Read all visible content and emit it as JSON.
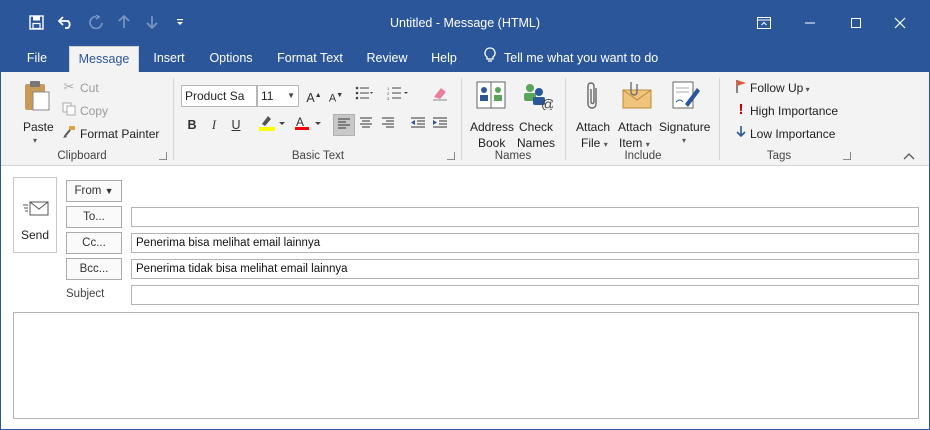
{
  "window": {
    "title": "Untitled  -  Message (HTML)"
  },
  "qat": {
    "save_icon": "save-icon",
    "undo_icon": "undo-icon",
    "redo_icon": "redo-icon",
    "up_icon": "arrow-up-icon",
    "down_icon": "arrow-down-icon",
    "customize_icon": "customize-icon"
  },
  "tabs": {
    "file": "File",
    "message": "Message",
    "insert": "Insert",
    "options": "Options",
    "format_text": "Format Text",
    "review": "Review",
    "help": "Help",
    "tell_me": "Tell me what you want to do"
  },
  "ribbon": {
    "clipboard": {
      "paste": "Paste",
      "cut": "Cut",
      "copy": "Copy",
      "format_painter": "Format Painter",
      "label": "Clipboard"
    },
    "basic_text": {
      "font": "Product Sa",
      "size": "11",
      "bold": "B",
      "italic": "I",
      "underline": "U",
      "label": "Basic Text"
    },
    "names": {
      "address_book_1": "Address",
      "address_book_2": "Book",
      "check_names_1": "Check",
      "check_names_2": "Names",
      "label": "Names"
    },
    "include": {
      "attach_file_1": "Attach",
      "attach_file_2": "File",
      "attach_item_1": "Attach",
      "attach_item_2": "Item",
      "signature": "Signature",
      "label": "Include"
    },
    "tags": {
      "follow_up": "Follow Up",
      "high_importance": "High Importance",
      "low_importance": "Low Importance",
      "label": "Tags"
    }
  },
  "compose": {
    "send": "Send",
    "from": "From",
    "to": "To...",
    "cc": "Cc...",
    "bcc": "Bcc...",
    "subject": "Subject",
    "to_value": "",
    "cc_value": "Penerima bisa melihat email lainnya",
    "bcc_value": "Penerima tidak bisa melihat email lainnya",
    "subject_value": ""
  },
  "colors": {
    "accent": "#2b579a",
    "highlight_yellow": "#ffff00",
    "font_red": "#ff0000",
    "importance_red": "#c00000",
    "low_blue": "#2b579a"
  }
}
